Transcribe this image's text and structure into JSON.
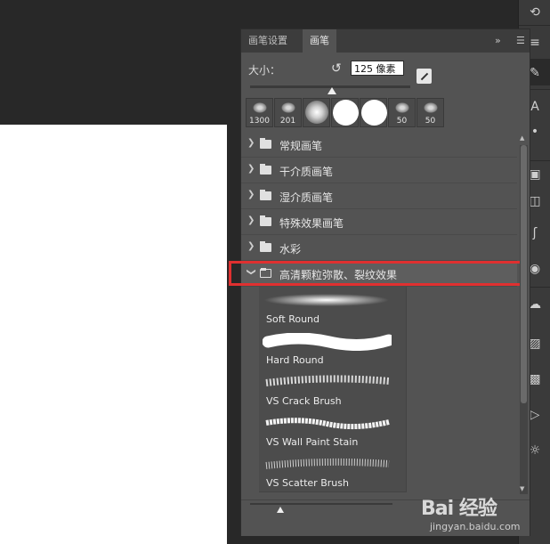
{
  "tabs": [
    {
      "label": "画笔设置"
    },
    {
      "label": "画笔"
    }
  ],
  "tab_menu": {
    "collapse": "»",
    "menu": "☰"
  },
  "size": {
    "label": "大小：",
    "value": "125 像素",
    "slider_fraction": 0.5
  },
  "presets": [
    {
      "label": "1300",
      "kind": "texture"
    },
    {
      "label": "201",
      "kind": "texture"
    },
    {
      "label": "",
      "kind": "soft"
    },
    {
      "label": "",
      "kind": "hard"
    },
    {
      "label": "",
      "kind": "hard"
    },
    {
      "label": "50",
      "kind": "texture"
    },
    {
      "label": "50",
      "kind": "texture"
    }
  ],
  "folders": [
    {
      "label": "常规画笔",
      "expanded": false
    },
    {
      "label": "干介质画笔",
      "expanded": false
    },
    {
      "label": "湿介质画笔",
      "expanded": false
    },
    {
      "label": "特殊效果画笔",
      "expanded": false
    },
    {
      "label": "水彩",
      "expanded": false
    },
    {
      "label": "高清颗粒弥散、裂纹效果",
      "expanded": true
    }
  ],
  "brushes": [
    {
      "label": "Soft Round"
    },
    {
      "label": "Hard Round"
    },
    {
      "label": "VS Crack Brush"
    },
    {
      "label": "VS Wall Paint Stain"
    },
    {
      "label": "VS Scatter Brush"
    }
  ],
  "watermark": {
    "logo": "Bai 经验",
    "url": "jingyan.baidu.com"
  },
  "colors": {
    "highlight": "#e03030",
    "panel": "#535353",
    "canvas": "#ffffff"
  }
}
